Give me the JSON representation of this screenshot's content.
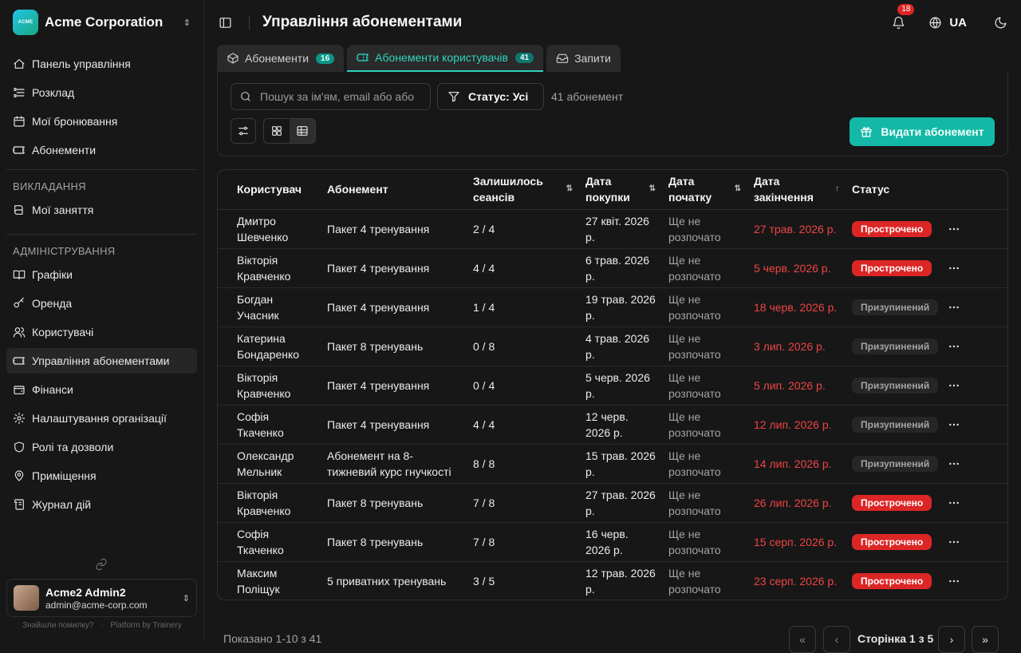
{
  "org": {
    "name": "Acme Corporation",
    "logo_text": "ACME"
  },
  "nav": {
    "main": [
      {
        "label": "Панель управління",
        "icon": "home-icon"
      },
      {
        "label": "Розклад",
        "icon": "list-icon"
      },
      {
        "label": "Мої бронювання",
        "icon": "calendar-icon"
      },
      {
        "label": "Абонементи",
        "icon": "ticket-icon"
      }
    ],
    "teaching_title": "ВИКЛАДАННЯ",
    "teaching": [
      {
        "label": "Мої заняття",
        "icon": "book-icon"
      }
    ],
    "admin_title": "АДМІНІСТРУВАННЯ",
    "admin": [
      {
        "label": "Графіки",
        "icon": "book-open-icon"
      },
      {
        "label": "Оренда",
        "icon": "key-icon"
      },
      {
        "label": "Користувачі",
        "icon": "users-icon"
      },
      {
        "label": "Управління абонементами",
        "icon": "ticket-icon"
      },
      {
        "label": "Фінанси",
        "icon": "wallet-icon"
      },
      {
        "label": "Налаштування організації",
        "icon": "settings-icon"
      },
      {
        "label": "Ролі та дозволи",
        "icon": "shield-icon"
      },
      {
        "label": "Приміщення",
        "icon": "map-pin-icon"
      },
      {
        "label": "Журнал дій",
        "icon": "scroll-icon"
      }
    ]
  },
  "user": {
    "name": "Acme2 Admin2",
    "email": "admin@acme-corp.com"
  },
  "footer": {
    "bug": "Знайшли помилку?",
    "dot": "·",
    "platform": "Platform by Trainery"
  },
  "header": {
    "title": "Управління абонементами",
    "notifications": "18",
    "lang": "UA"
  },
  "tabs": [
    {
      "label": "Абонементи",
      "count": "16"
    },
    {
      "label": "Абонементи користувачів",
      "count": "41"
    },
    {
      "label": "Запити"
    }
  ],
  "toolbar": {
    "search_placeholder": "Пошук за ім'ям, email або або",
    "filter_label": "Статус: Усі",
    "count_text": "41 абонемент",
    "issue_button": "Видати абонемент"
  },
  "table": {
    "columns": [
      "Користувач",
      "Абонемент",
      "Залишилось сеансів",
      "Дата покупки",
      "Дата початку",
      "Дата закінчення",
      "Статус"
    ],
    "rows": [
      {
        "user": "Дмитро Шевченко",
        "plan": "Пакет 4 тренування",
        "left": "2 / 4",
        "bought": "27 квіт. 2026 р.",
        "start": "Ще не розпочато",
        "end": "27 трав. 2026 р.",
        "status": "Прострочено"
      },
      {
        "user": "Вікторія Кравченко",
        "plan": "Пакет 4 тренування",
        "left": "4 / 4",
        "bought": "6 трав. 2026 р.",
        "start": "Ще не розпочато",
        "end": "5 черв. 2026 р.",
        "status": "Прострочено"
      },
      {
        "user": "Богдан Учасник",
        "plan": "Пакет 4 тренування",
        "left": "1 / 4",
        "bought": "19 трав. 2026 р.",
        "start": "Ще не розпочато",
        "end": "18 черв. 2026 р.",
        "status": "Призупинений"
      },
      {
        "user": "Катерина Бондаренко",
        "plan": "Пакет 8 тренувань",
        "left": "0 / 8",
        "bought": "4 трав. 2026 р.",
        "start": "Ще не розпочато",
        "end": "3 лип. 2026 р.",
        "status": "Призупинений"
      },
      {
        "user": "Вікторія Кравченко",
        "plan": "Пакет 4 тренування",
        "left": "0 / 4",
        "bought": "5 черв. 2026 р.",
        "start": "Ще не розпочато",
        "end": "5 лип. 2026 р.",
        "status": "Призупинений"
      },
      {
        "user": "Софія Ткаченко",
        "plan": "Пакет 4 тренування",
        "left": "4 / 4",
        "bought": "12 черв. 2026 р.",
        "start": "Ще не розпочато",
        "end": "12 лип. 2026 р.",
        "status": "Призупинений"
      },
      {
        "user": "Олександр Мельник",
        "plan": "Абонемент на 8-тижневий курс гнучкості",
        "left": "8 / 8",
        "bought": "15 трав. 2026 р.",
        "start": "Ще не розпочато",
        "end": "14 лип. 2026 р.",
        "status": "Призупинений"
      },
      {
        "user": "Вікторія Кравченко",
        "plan": "Пакет 8 тренувань",
        "left": "7 / 8",
        "bought": "27 трав. 2026 р.",
        "start": "Ще не розпочато",
        "end": "26 лип. 2026 р.",
        "status": "Прострочено"
      },
      {
        "user": "Софія Ткаченко",
        "plan": "Пакет 8 тренувань",
        "left": "7 / 8",
        "bought": "16 черв. 2026 р.",
        "start": "Ще не розпочато",
        "end": "15 серп. 2026 р.",
        "status": "Прострочено"
      },
      {
        "user": "Максим Поліщук",
        "plan": "5 приватних тренувань",
        "left": "3 / 5",
        "bought": "12 трав. 2026 р.",
        "start": "Ще не розпочато",
        "end": "23 серп. 2026 р.",
        "status": "Прострочено"
      }
    ]
  },
  "pager": {
    "shown": "Показано 1-10 з 41",
    "page": "Сторінка 1 з 5"
  },
  "colors": {
    "accent": "#14b8a6",
    "danger": "#dc2626",
    "bg": "#171717"
  }
}
